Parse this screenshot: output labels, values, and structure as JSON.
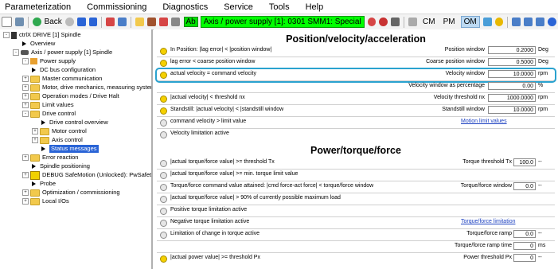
{
  "menu": [
    "Parameterization",
    "Commissioning",
    "Diagnostics",
    "Service",
    "Tools",
    "Help"
  ],
  "toolbar": {
    "back_label": "Back",
    "ab_label": "Ab",
    "axis_label": "Axis / power supply [1]:  0301 SMM1: Special",
    "modes": [
      "CM",
      "PM",
      "OM"
    ],
    "active_mode": "OM"
  },
  "tree": {
    "items": [
      {
        "label": "ctrlX DRIVE [1] Spindle"
      },
      {
        "label": "Overview"
      },
      {
        "label": "Axis / power supply [1] Spindle"
      },
      {
        "label": "Power supply"
      },
      {
        "label": "DC bus configuration"
      },
      {
        "label": "Master communication"
      },
      {
        "label": "Motor, drive mechanics, measuring systems"
      },
      {
        "label": "Operation modes / Drive Halt"
      },
      {
        "label": "Limit values"
      },
      {
        "label": "Drive control"
      },
      {
        "label": "Drive control overview"
      },
      {
        "label": "Motor control"
      },
      {
        "label": "Axis control"
      },
      {
        "label": "Status messages"
      },
      {
        "label": "Error reaction"
      },
      {
        "label": "Spindle positioning"
      },
      {
        "label": "DEBUG SafeMotion (Unlocked): PwSafety"
      },
      {
        "label": "Probe"
      },
      {
        "label": "Optimization / commissioning"
      },
      {
        "label": "Local I/Os"
      }
    ]
  },
  "section1": {
    "title": "Position/velocity/acceleration",
    "rows": [
      {
        "label": "In Position: |lag error| < |position window|",
        "param": "Position window",
        "value": "0.2000",
        "unit": "Deg",
        "led": "yellow"
      },
      {
        "label": "lag error < coarse position window",
        "param": "Coarse position window",
        "value": "0.5000",
        "unit": "Deg",
        "led": "yellow"
      },
      {
        "label": "actual velocity = command velocity",
        "param": "Velocity window",
        "value": "10.0000",
        "unit": "rpm",
        "led": "yellow"
      },
      {
        "label": "",
        "param": "Velocity window as percentage",
        "value": "0.00",
        "unit": "%",
        "led": ""
      },
      {
        "label": "|actual velocity| < threshold nx",
        "param": "Velocity threshold nx",
        "value": "1000.0000",
        "unit": "rpm",
        "led": "yellow"
      },
      {
        "label": "Standstill: |actual velocity| < |standstill window",
        "param": "Standstill window",
        "value": "10.0000",
        "unit": "rpm",
        "led": "yellow"
      },
      {
        "label": "command velocity > limit value",
        "link": "Motion limit values",
        "led": "grey"
      },
      {
        "label": "Velocity limitation active",
        "led": "grey"
      }
    ]
  },
  "section2": {
    "title": "Power/torque/force",
    "rows": [
      {
        "label": "|actual torque/force value| >= threshold Tx",
        "param": "Torque threshold Tx",
        "value": "100.0",
        "unit": "--",
        "led": "grey"
      },
      {
        "label": "|actual torque/force value| >= min. torque limit value",
        "led": "grey"
      },
      {
        "label": "Torque/force command value attained: |cmd force-act force| < torque/force window",
        "param": "Torque/force window",
        "value": "0.0",
        "unit": "--",
        "led": "grey"
      },
      {
        "label": "|actual torque/force value| > 90% of currently possible maximum load",
        "led": "grey"
      },
      {
        "label": "Positive torque limitation active",
        "led": "grey"
      },
      {
        "label": "Negative torque limitation active",
        "link": "Torque/force limitation",
        "led": "grey"
      },
      {
        "label": "Limitation of change in torque active",
        "param": "Torque/force ramp",
        "value": "0.0",
        "unit": "--",
        "led": "grey"
      },
      {
        "label": "",
        "param": "Torque/force ramp time",
        "value": "0",
        "unit": "ms",
        "led": ""
      },
      {
        "label": "|actual power value| >= threshold Px",
        "param": "Power threshold Px",
        "value": "0",
        "unit": "--",
        "led": "yellow"
      }
    ]
  }
}
